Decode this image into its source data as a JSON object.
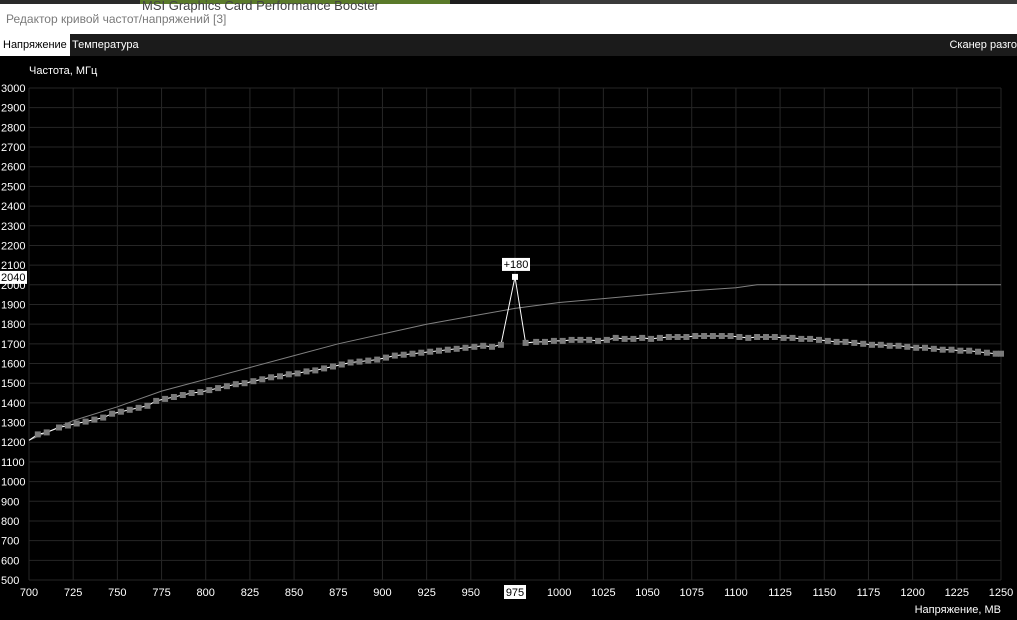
{
  "window": {
    "title": "Редактор кривой частот/напряжений [3]",
    "background_title": "MSI Graphics Card Performance Booster"
  },
  "tabs": [
    {
      "label": "Напряжение",
      "active": true
    },
    {
      "label": "Температура",
      "active": false
    }
  ],
  "scanner_label": "Сканер разго",
  "colors": {
    "background": "#000000",
    "grid": "#262626",
    "curve": "#ffffff",
    "reference_curve": "#808080",
    "point": "#7a7a7a",
    "selected_point": "#ffffff"
  },
  "chart_data": {
    "type": "line",
    "ylabel": "Частота, МГц",
    "xlabel": "Напряжение, МВ",
    "xlim": [
      700,
      1250
    ],
    "ylim": [
      500,
      3000
    ],
    "x_ticks": [
      700,
      725,
      750,
      775,
      800,
      825,
      850,
      875,
      900,
      925,
      950,
      975,
      1000,
      1025,
      1050,
      1075,
      1100,
      1125,
      1150,
      1175,
      1200,
      1225,
      1250
    ],
    "y_ticks": [
      500,
      600,
      700,
      800,
      900,
      1000,
      1100,
      1200,
      1300,
      1400,
      1500,
      1600,
      1700,
      1800,
      1900,
      2000,
      2100,
      2200,
      2300,
      2400,
      2500,
      2600,
      2700,
      2800,
      2900,
      3000
    ],
    "grid": true,
    "selected": {
      "x": 975,
      "y": 2040,
      "label": "+180"
    },
    "series": [
      {
        "role": "reference",
        "x": [
          700,
          725,
          750,
          775,
          800,
          825,
          850,
          875,
          900,
          925,
          950,
          975,
          1000,
          1025,
          1050,
          1075,
          1100,
          1112,
          1125,
          1150,
          1175,
          1200,
          1225,
          1250
        ],
        "y": [
          1210,
          1310,
          1380,
          1460,
          1520,
          1580,
          1640,
          1700,
          1750,
          1800,
          1840,
          1880,
          1910,
          1930,
          1950,
          1970,
          1985,
          2000,
          2000,
          2000,
          2000,
          2000,
          2000,
          2000
        ]
      },
      {
        "role": "curve",
        "points": [
          [
            700,
            1210
          ],
          [
            705,
            1240
          ],
          [
            710,
            1250
          ],
          [
            717,
            1275
          ],
          [
            722,
            1285
          ],
          [
            727,
            1295
          ],
          [
            732,
            1305
          ],
          [
            737,
            1315
          ],
          [
            742,
            1325
          ],
          [
            747,
            1345
          ],
          [
            752,
            1355
          ],
          [
            757,
            1365
          ],
          [
            762,
            1375
          ],
          [
            767,
            1385
          ],
          [
            772,
            1410
          ],
          [
            777,
            1420
          ],
          [
            782,
            1430
          ],
          [
            787,
            1440
          ],
          [
            792,
            1450
          ],
          [
            797,
            1455
          ],
          [
            802,
            1465
          ],
          [
            807,
            1475
          ],
          [
            812,
            1485
          ],
          [
            817,
            1495
          ],
          [
            822,
            1500
          ],
          [
            827,
            1510
          ],
          [
            832,
            1520
          ],
          [
            837,
            1530
          ],
          [
            842,
            1535
          ],
          [
            847,
            1545
          ],
          [
            852,
            1550
          ],
          [
            857,
            1560
          ],
          [
            862,
            1565
          ],
          [
            867,
            1575
          ],
          [
            872,
            1585
          ],
          [
            877,
            1595
          ],
          [
            882,
            1605
          ],
          [
            887,
            1610
          ],
          [
            892,
            1615
          ],
          [
            897,
            1620
          ],
          [
            902,
            1630
          ],
          [
            907,
            1640
          ],
          [
            912,
            1645
          ],
          [
            917,
            1650
          ],
          [
            922,
            1655
          ],
          [
            927,
            1660
          ],
          [
            932,
            1665
          ],
          [
            937,
            1670
          ],
          [
            942,
            1675
          ],
          [
            947,
            1680
          ],
          [
            952,
            1685
          ],
          [
            957,
            1690
          ],
          [
            962,
            1685
          ],
          [
            967,
            1695
          ],
          [
            975,
            2040
          ],
          [
            981,
            1705
          ],
          [
            987,
            1710
          ],
          [
            992,
            1710
          ],
          [
            997,
            1715
          ],
          [
            1002,
            1715
          ],
          [
            1007,
            1720
          ],
          [
            1012,
            1720
          ],
          [
            1017,
            1720
          ],
          [
            1022,
            1715
          ],
          [
            1027,
            1720
          ],
          [
            1032,
            1730
          ],
          [
            1037,
            1725
          ],
          [
            1042,
            1725
          ],
          [
            1047,
            1730
          ],
          [
            1052,
            1725
          ],
          [
            1057,
            1730
          ],
          [
            1062,
            1735
          ],
          [
            1067,
            1735
          ],
          [
            1072,
            1735
          ],
          [
            1077,
            1740
          ],
          [
            1082,
            1740
          ],
          [
            1087,
            1740
          ],
          [
            1092,
            1740
          ],
          [
            1097,
            1740
          ],
          [
            1102,
            1735
          ],
          [
            1107,
            1730
          ],
          [
            1112,
            1735
          ],
          [
            1117,
            1735
          ],
          [
            1122,
            1735
          ],
          [
            1127,
            1730
          ],
          [
            1132,
            1730
          ],
          [
            1137,
            1725
          ],
          [
            1142,
            1725
          ],
          [
            1147,
            1720
          ],
          [
            1152,
            1715
          ],
          [
            1157,
            1710
          ],
          [
            1162,
            1710
          ],
          [
            1167,
            1705
          ],
          [
            1172,
            1700
          ],
          [
            1177,
            1695
          ],
          [
            1182,
            1695
          ],
          [
            1187,
            1690
          ],
          [
            1192,
            1690
          ],
          [
            1197,
            1685
          ],
          [
            1202,
            1680
          ],
          [
            1207,
            1680
          ],
          [
            1212,
            1675
          ],
          [
            1217,
            1670
          ],
          [
            1222,
            1670
          ],
          [
            1227,
            1665
          ],
          [
            1232,
            1665
          ],
          [
            1237,
            1660
          ],
          [
            1242,
            1655
          ],
          [
            1247,
            1650
          ],
          [
            1250,
            1650
          ]
        ]
      }
    ]
  }
}
